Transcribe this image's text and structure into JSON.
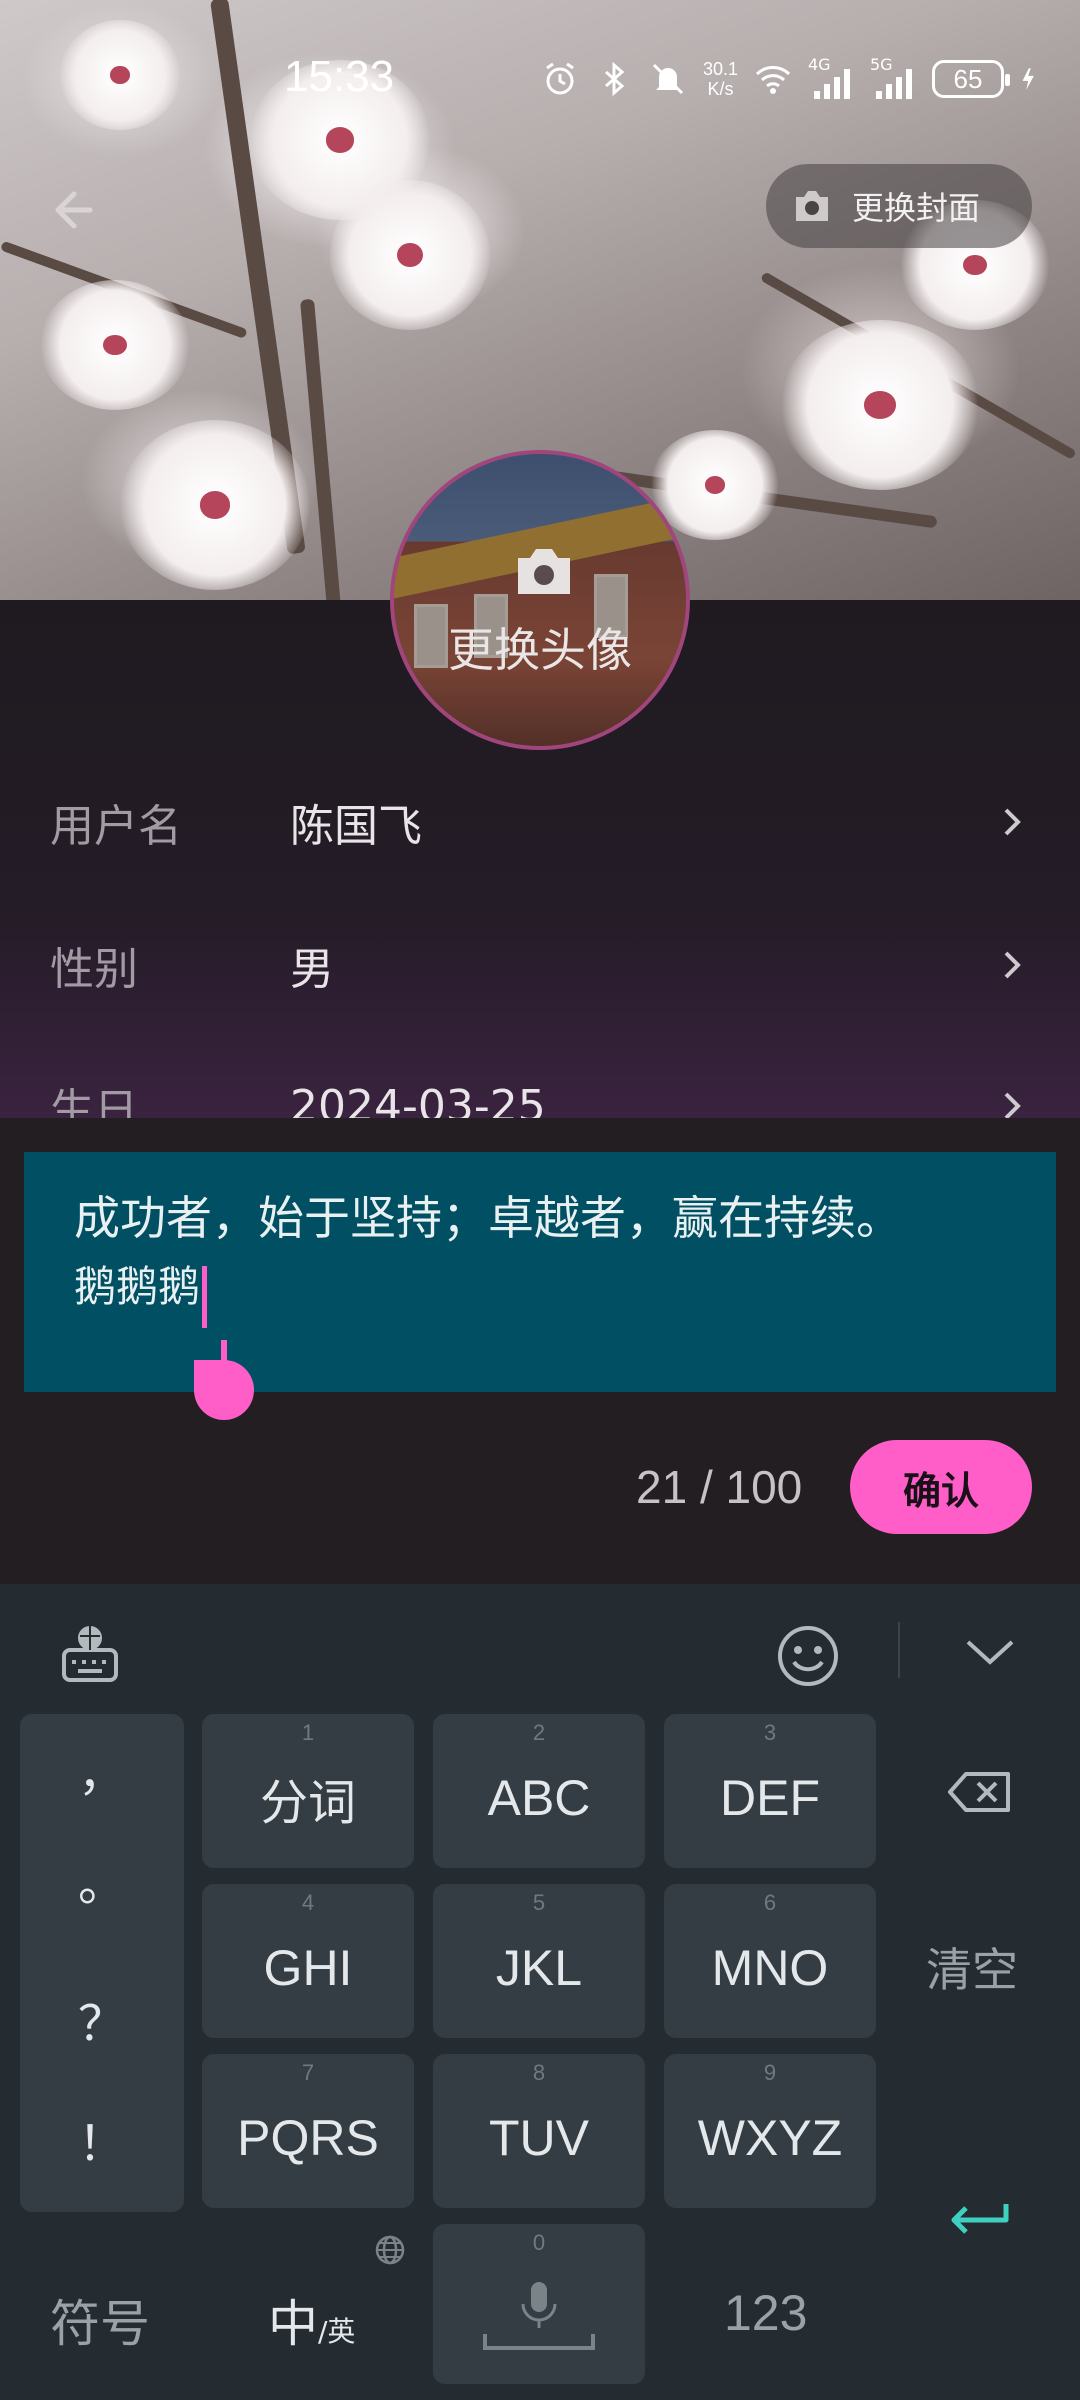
{
  "status_bar": {
    "time": "15:33",
    "network_speed_value": "30.1",
    "network_speed_unit": "K/s",
    "signal_1": "4G",
    "signal_2": "5G",
    "battery": "65"
  },
  "header": {
    "change_cover_label": "更换封面"
  },
  "avatar": {
    "change_avatar_label": "更换头像"
  },
  "profile_fields": [
    {
      "key": "用户名",
      "value": "陈国飞"
    },
    {
      "key": "性别",
      "value": "男"
    },
    {
      "key": "生日",
      "value": "2024-03-25"
    }
  ],
  "signature_editor": {
    "line1": "成功者，始于坚持；卓越者，赢在持续。",
    "line2": "鹅鹅鹅",
    "counter": "21 / 100",
    "confirm_label": "确认"
  },
  "keyboard": {
    "punctuation": [
      "，",
      "。",
      "？",
      "！"
    ],
    "keys": [
      {
        "num": "1",
        "label": "分词"
      },
      {
        "num": "2",
        "label": "ABC"
      },
      {
        "num": "3",
        "label": "DEF"
      },
      {
        "num": "4",
        "label": "GHI"
      },
      {
        "num": "5",
        "label": "JKL"
      },
      {
        "num": "6",
        "label": "MNO"
      },
      {
        "num": "7",
        "label": "PQRS"
      },
      {
        "num": "8",
        "label": "TUV"
      },
      {
        "num": "9",
        "label": "WXYZ"
      },
      {
        "num": "0",
        "label": ""
      }
    ],
    "clear_label": "清空",
    "symbols_label": "符号",
    "lang_main": "中",
    "lang_sub": "/英",
    "numbers_label": "123",
    "accent_color": "#3fd0c0"
  },
  "colors": {
    "accent_pink": "#ff5ec8",
    "editor_bg": "#004f62"
  }
}
